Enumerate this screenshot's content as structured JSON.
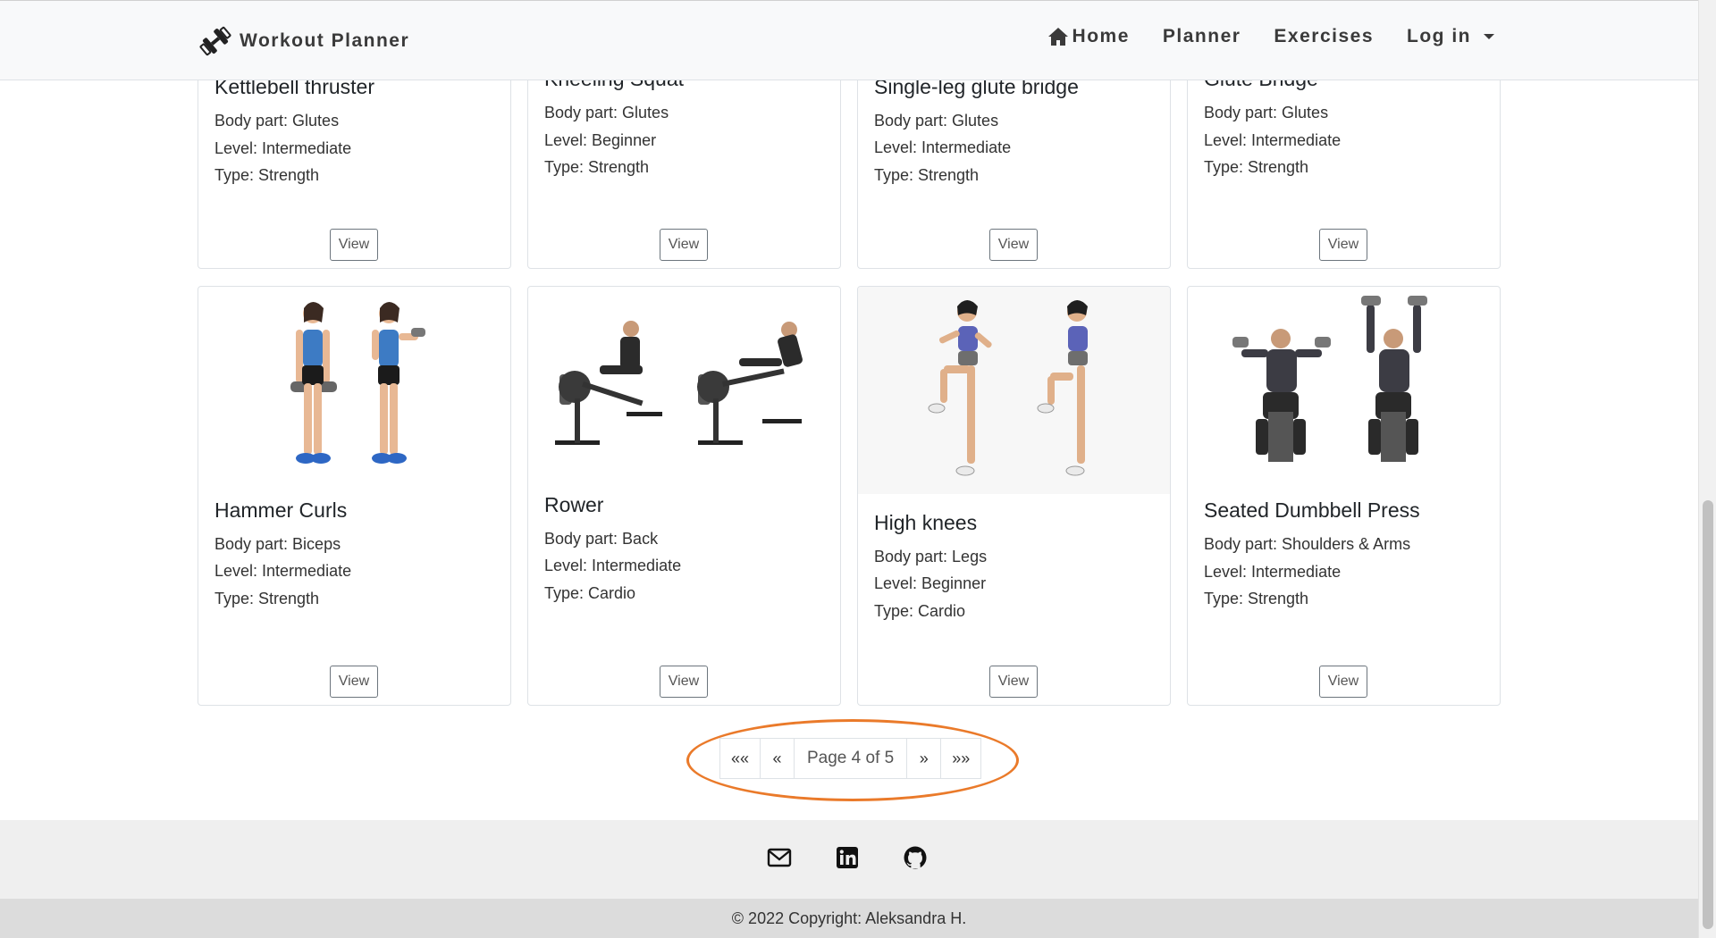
{
  "navbar": {
    "brand": "Workout Planner",
    "brand_icon": "dumbbell-icon",
    "links": [
      {
        "label": "Home",
        "icon": "home-icon"
      },
      {
        "label": "Planner"
      },
      {
        "label": "Exercises"
      },
      {
        "label": "Log in",
        "icon": "caret-down-icon"
      }
    ]
  },
  "cards_top_row": [
    {
      "title": "Kettlebell thruster",
      "body_part": "Body part: Glutes",
      "level": "Level: Intermediate",
      "type": "Type: Strength",
      "view_label": "View"
    },
    {
      "title": "Kneeling Squat",
      "body_part": "Body part: Glutes",
      "level": "Level: Beginner",
      "type": "Type: Strength",
      "view_label": "View"
    },
    {
      "title": "Single-leg glute bridge",
      "body_part": "Body part: Glutes",
      "level": "Level: Intermediate",
      "type": "Type: Strength",
      "view_label": "View"
    },
    {
      "title": "Glute Bridge",
      "body_part": "Body part: Glutes",
      "level": "Level: Intermediate",
      "type": "Type: Strength",
      "view_label": "View"
    }
  ],
  "cards_bottom_row": [
    {
      "title": "Hammer Curls",
      "body_part": "Body part: Biceps",
      "level": "Level: Intermediate",
      "type": "Type: Strength",
      "view_label": "View"
    },
    {
      "title": "Rower",
      "body_part": "Body part: Back",
      "level": "Level: Intermediate",
      "type": "Type: Cardio",
      "view_label": "View"
    },
    {
      "title": "High knees",
      "body_part": "Body part: Legs",
      "level": "Level: Beginner",
      "type": "Type: Cardio",
      "view_label": "View"
    },
    {
      "title": "Seated Dumbbell Press",
      "body_part": "Body part: Shoulders & Arms",
      "level": "Level: Intermediate",
      "type": "Type: Strength",
      "view_label": "View"
    }
  ],
  "pagination": {
    "first": "««",
    "prev": "«",
    "status": "Page 4 of 5",
    "next": "»",
    "last": "»»",
    "highlight_color": "#ea7a2a"
  },
  "footer": {
    "icons": [
      "mail-icon",
      "linkedin-icon",
      "github-icon"
    ],
    "copyright": "© 2022 Copyright: Aleksandra H."
  }
}
